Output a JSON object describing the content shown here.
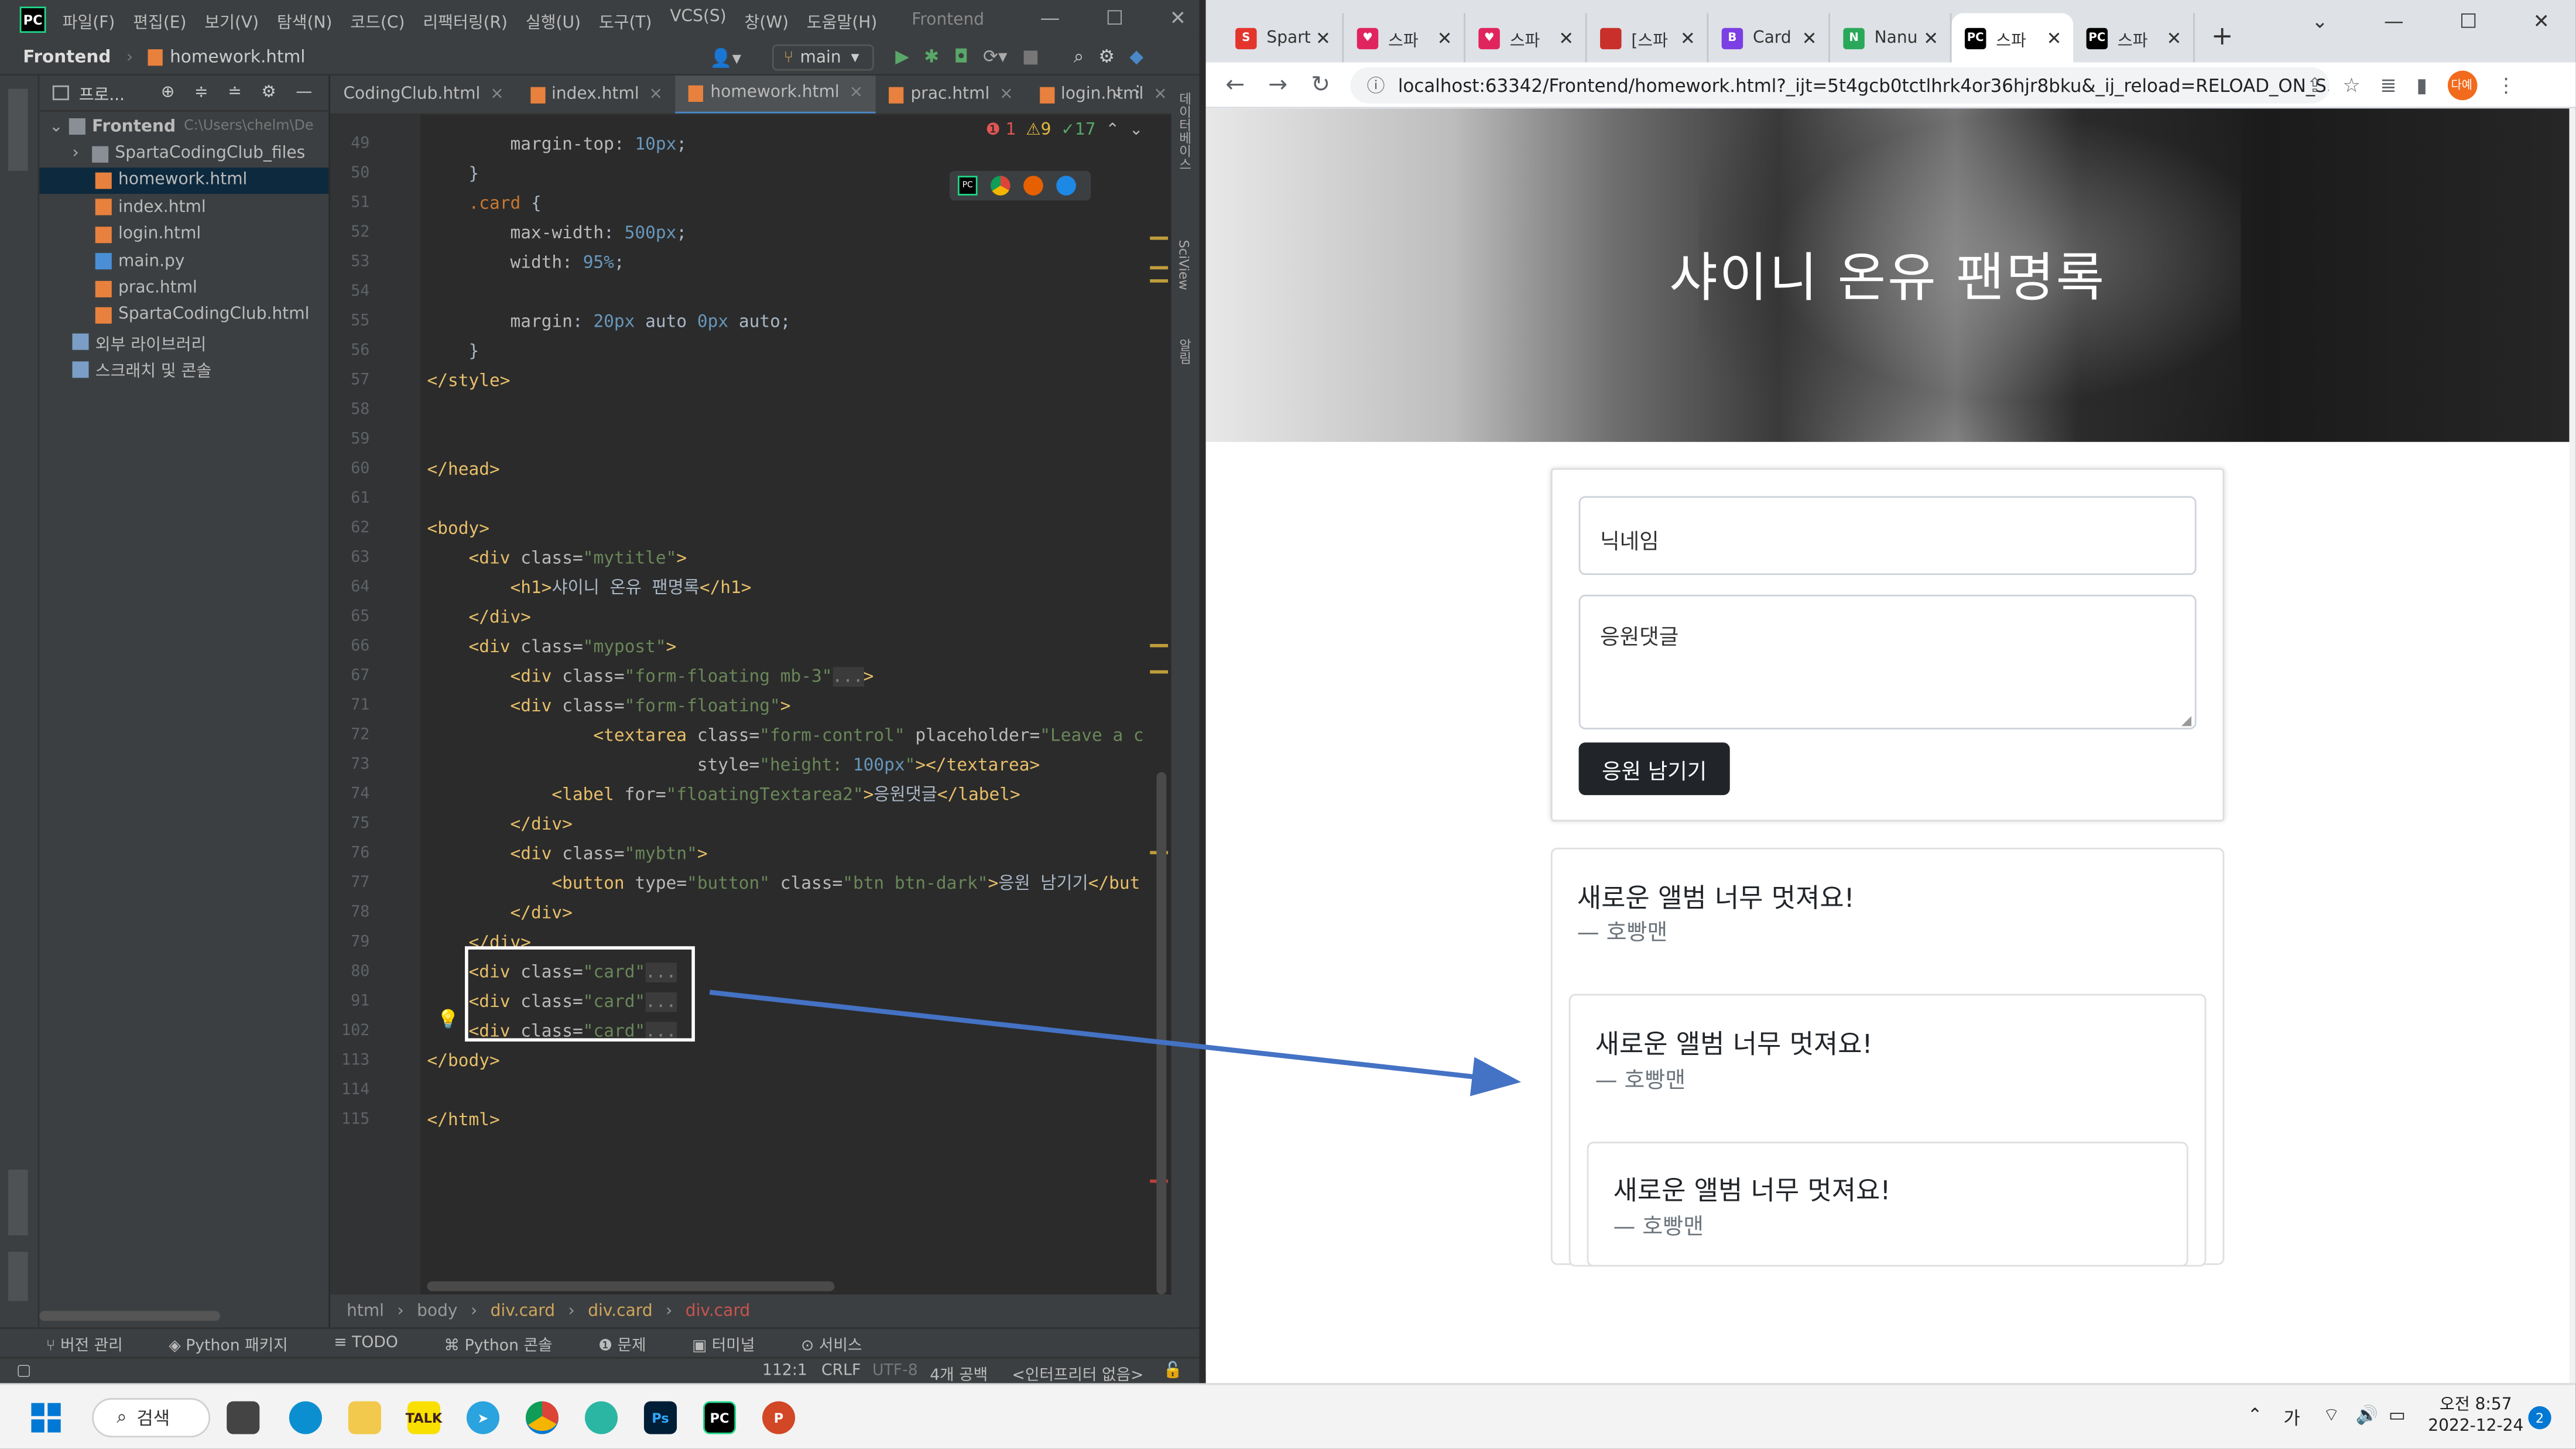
{
  "ide": {
    "menu": [
      "파일(F)",
      "편집(E)",
      "보기(V)",
      "탐색(N)",
      "코드(C)",
      "리팩터링(R)",
      "실행(U)",
      "도구(T)",
      "VCS(S)",
      "창(W)",
      "도움말(H)"
    ],
    "project_title": "Frontend",
    "breadcrumb_project": "Frontend",
    "breadcrumb_file": "homework.html",
    "branch": "main",
    "project_panel_label": "프로...",
    "tree": [
      {
        "label": "Frontend",
        "path": "C:\\Users\\chelm\\De",
        "icon": "folder",
        "indent": 0
      },
      {
        "label": "SpartaCodingClub_files",
        "icon": "folder",
        "indent": 1
      },
      {
        "label": "homework.html",
        "icon": "html",
        "indent": 2,
        "selected": true
      },
      {
        "label": "index.html",
        "icon": "html",
        "indent": 2
      },
      {
        "label": "login.html",
        "icon": "html",
        "indent": 2
      },
      {
        "label": "main.py",
        "icon": "py",
        "indent": 2
      },
      {
        "label": "prac.html",
        "icon": "html",
        "indent": 2
      },
      {
        "label": "SpartaCodingClub.html",
        "icon": "html",
        "indent": 2
      },
      {
        "label": "외부 라이브러리",
        "icon": "lib",
        "indent": 1
      },
      {
        "label": "스크래치 및 콘솔",
        "icon": "lib",
        "indent": 1
      }
    ],
    "tabs": [
      {
        "label": "CodingClub.html",
        "active": false
      },
      {
        "label": "index.html",
        "active": false
      },
      {
        "label": "homework.html",
        "active": true
      },
      {
        "label": "prac.html",
        "active": false
      },
      {
        "label": "login.html",
        "active": false
      }
    ],
    "inspections": {
      "errors": "1",
      "warnings": "9",
      "weak": "17"
    },
    "lines": [
      {
        "n": "49",
        "html": "        <span class='prop'>margin-top</span>: <span class='num'>10px</span>;"
      },
      {
        "n": "50",
        "html": "    }"
      },
      {
        "n": "51",
        "html": "    <span class='sel-css'>.card</span> {"
      },
      {
        "n": "52",
        "html": "        <span class='prop'>max-width</span>: <span class='num'>500px</span>;"
      },
      {
        "n": "53",
        "html": "        <span class='prop'>width</span>: <span class='num'>95%</span>;"
      },
      {
        "n": "54",
        "html": ""
      },
      {
        "n": "55",
        "html": "        <span class='prop'>margin</span>: <span class='num'>20px</span> auto <span class='num'>0px</span> auto;"
      },
      {
        "n": "56",
        "html": "    }"
      },
      {
        "n": "57",
        "html": "<span class='tag'>&lt;/style&gt;</span>"
      },
      {
        "n": "58",
        "html": ""
      },
      {
        "n": "59",
        "html": ""
      },
      {
        "n": "60",
        "html": "<span class='tag'>&lt;/head&gt;</span>"
      },
      {
        "n": "61",
        "html": ""
      },
      {
        "n": "62",
        "html": "<span class='tag'>&lt;body&gt;</span>"
      },
      {
        "n": "63",
        "html": "    <span class='tag'>&lt;div</span> <span class='attr'>class=</span><span class='str'>\"mytitle\"</span><span class='tag'>&gt;</span>"
      },
      {
        "n": "64",
        "html": "        <span class='tag'>&lt;h1&gt;</span>샤이니 온유 팬명록<span class='tag'>&lt;/h1&gt;</span>"
      },
      {
        "n": "65",
        "html": "    <span class='tag'>&lt;/div&gt;</span>"
      },
      {
        "n": "66",
        "html": "    <span class='tag'>&lt;div</span> <span class='attr'>class=</span><span class='str'>\"mypost\"</span><span class='tag'>&gt;</span>"
      },
      {
        "n": "67",
        "html": "        <span class='tag'>&lt;div</span> <span class='attr'>class=</span><span class='str'>\"form-floating mb-3\"</span><span class='fold'>...</span><span class='tag'>&gt;</span>"
      },
      {
        "n": "71",
        "html": "        <span class='tag'>&lt;div</span> <span class='attr'>class=</span><span class='str'>\"form-floating\"</span><span class='tag'>&gt;</span>"
      },
      {
        "n": "72",
        "html": "                <span class='tag'>&lt;textarea</span> <span class='attr'>class=</span><span class='str'>\"form-control\"</span> <span class='attr'>placeholder=</span><span class='str'>\"Leave a c</span>"
      },
      {
        "n": "73",
        "html": "                          <span class='attr'>style=</span><span class='str'>\"height: <span class='num'>100px</span>\"</span><span class='tag'>&gt;&lt;/textarea&gt;</span>"
      },
      {
        "n": "74",
        "html": "            <span class='tag'>&lt;label</span> <span class='attr'>for=</span><span class='str'>\"floatingTextarea2\"</span><span class='tag'>&gt;</span>응원댓글<span class='tag'>&lt;/label&gt;</span>"
      },
      {
        "n": "75",
        "html": "        <span class='tag'>&lt;/div&gt;</span>"
      },
      {
        "n": "76",
        "html": "        <span class='tag'>&lt;div</span> <span class='attr'>class=</span><span class='str'>\"mybtn\"</span><span class='tag'>&gt;</span>"
      },
      {
        "n": "77",
        "html": "            <span class='tag'>&lt;button</span> <span class='attr'>type=</span><span class='str'>\"button\"</span> <span class='attr'>class=</span><span class='str'>\"btn btn-dark\"</span><span class='tag'>&gt;</span>응원 남기기<span class='tag'>&lt;/but</span>"
      },
      {
        "n": "78",
        "html": "        <span class='tag'>&lt;/div&gt;</span>"
      },
      {
        "n": "79",
        "html": "    <span class='tag'>&lt;/div&gt;</span>"
      },
      {
        "n": "80",
        "html": "    <span class='tag'>&lt;div</span> <span class='attr'>class=</span><span class='str'>\"card\"</span><span class='fold'>...</span>"
      },
      {
        "n": "91",
        "html": "    <span class='tag'>&lt;div</span> <span class='attr'>class=</span><span class='str'>\"card\"</span><span class='fold'>...</span>"
      },
      {
        "n": "102",
        "html": "    <span class='tag'>&lt;div</span> <span class='attr'>class=</span><span class='str'>\"card\"</span><span class='fold'>...</span>"
      },
      {
        "n": "113",
        "html": "<span class='tag'>&lt;/body&gt;</span>"
      },
      {
        "n": "114",
        "html": ""
      },
      {
        "n": "115",
        "html": "<span class='tag'>&lt;/html&gt;</span>"
      }
    ],
    "bottom_breadcrumb": [
      "html",
      "body",
      "div.card",
      "div.card",
      "div.card"
    ],
    "tool_windows": [
      "버전 관리",
      "Python 패키지",
      "TODO",
      "Python 콘솔",
      "문제",
      "터미널",
      "서비스"
    ],
    "status": {
      "position": "112:1",
      "line_sep": "CRLF",
      "encoding": "UTF-8",
      "indent": "4개 공백",
      "interpreter": "<인터프리터 없음>"
    }
  },
  "browser": {
    "tabs": [
      {
        "label": "Spart",
        "fav_color": "#e4352d",
        "fav_text": "S"
      },
      {
        "label": "스파",
        "fav_color": "#e0245e",
        "fav_text": "♥"
      },
      {
        "label": "스파",
        "fav_color": "#e0245e",
        "fav_text": "♥"
      },
      {
        "label": "[스파",
        "fav_color": "#c9302c",
        "fav_text": ""
      },
      {
        "label": "Card",
        "fav_color": "#7b3fe4",
        "fav_text": "B"
      },
      {
        "label": "Nanu",
        "fav_color": "#2aa85a",
        "fav_text": "N"
      },
      {
        "label": "스파",
        "fav_color": "#000000",
        "fav_text": "PC",
        "active": true
      },
      {
        "label": "스파",
        "fav_color": "#000000",
        "fav_text": "PC"
      }
    ],
    "url": "localhost:63342/Frontend/homework.html?_ijt=5t4gcb0tctlhrk4or36hjr8bku&_ij_reload=RELOAD_ON_S...",
    "avatar_text": "다예",
    "page": {
      "title": "샤이니 온유 팬명록",
      "nickname_placeholder": "닉네임",
      "comment_placeholder": "응원댓글",
      "submit_label": "응원 남기기",
      "cards": [
        {
          "text": "새로운 앨범 너무 멋져요!",
          "author": "— 호빵맨"
        },
        {
          "text": "새로운 앨범 너무 멋져요!",
          "author": "— 호빵맨"
        },
        {
          "text": "새로운 앨범 너무 멋져요!",
          "author": "— 호빵맨"
        }
      ]
    }
  },
  "taskbar": {
    "search_label": "검색",
    "lang": "가",
    "time": "오전 8:57",
    "date": "2022-12-24",
    "notifications": "2"
  },
  "colors": {
    "arrow": "#4472c4",
    "highlight_box": "#ffffff"
  }
}
